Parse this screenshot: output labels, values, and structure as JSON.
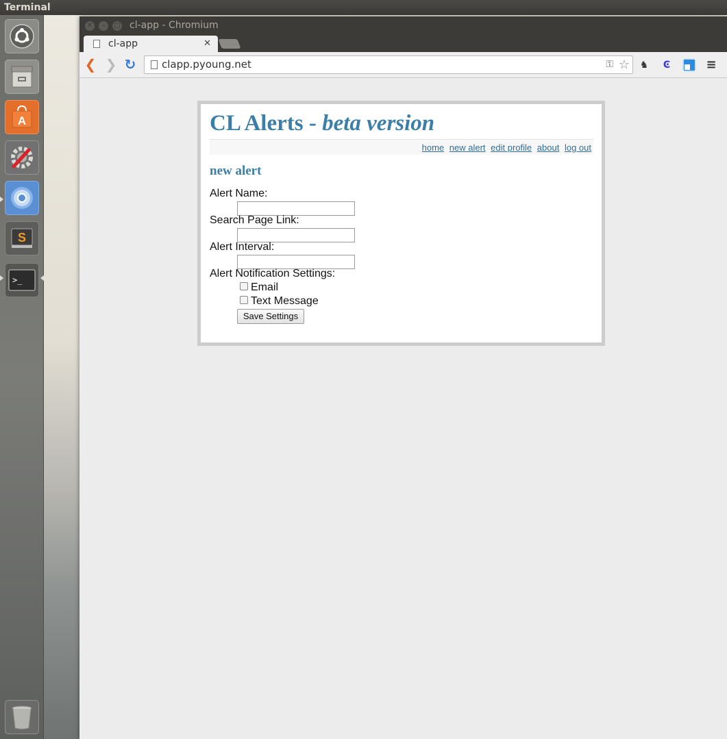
{
  "desktop": {
    "top_panel_title": "Terminal"
  },
  "launcher": {
    "items": [
      {
        "name": "Ubuntu Dash",
        "icon": "ubuntu-logo-icon"
      },
      {
        "name": "Files",
        "icon": "file-cabinet-icon"
      },
      {
        "name": "Ubuntu Software Center",
        "icon": "shopping-bag-icon"
      },
      {
        "name": "System Settings",
        "icon": "settings-wrench-icon"
      },
      {
        "name": "Chromium",
        "icon": "chromium-icon"
      },
      {
        "name": "Sublime Text",
        "icon": "sublime-text-icon"
      },
      {
        "name": "Terminal",
        "icon": "terminal-icon"
      },
      {
        "name": "Trash",
        "icon": "trash-icon"
      }
    ],
    "sublime_glyph": "S",
    "terminal_glyph": ">_"
  },
  "browser": {
    "window_title": "cl-app - Chromium",
    "tab": {
      "title": "cl-app",
      "close_glyph": "✕"
    },
    "address": "clapp.pyoung.net",
    "colors": {
      "back_arrow": "#e2662a",
      "reload": "#3a7bd5"
    }
  },
  "page": {
    "title_main": "CL Alerts - ",
    "title_beta": "beta version",
    "nav": [
      "home",
      "new alert",
      "edit profile",
      "about",
      "log out"
    ],
    "section_title": "new alert",
    "form": {
      "alert_name_label": "Alert Name:",
      "alert_name_value": "",
      "search_link_label": "Search Page Link:",
      "search_link_value": "",
      "interval_label": "Alert Interval:",
      "interval_value": "",
      "notification_label": "Alert Notification Settings:",
      "email_label": "Email",
      "email_checked": false,
      "text_label": "Text Message",
      "text_checked": false,
      "save_label": "Save Settings"
    },
    "colors": {
      "heading": "#3b7fa8",
      "link": "#2f6d9a"
    }
  }
}
